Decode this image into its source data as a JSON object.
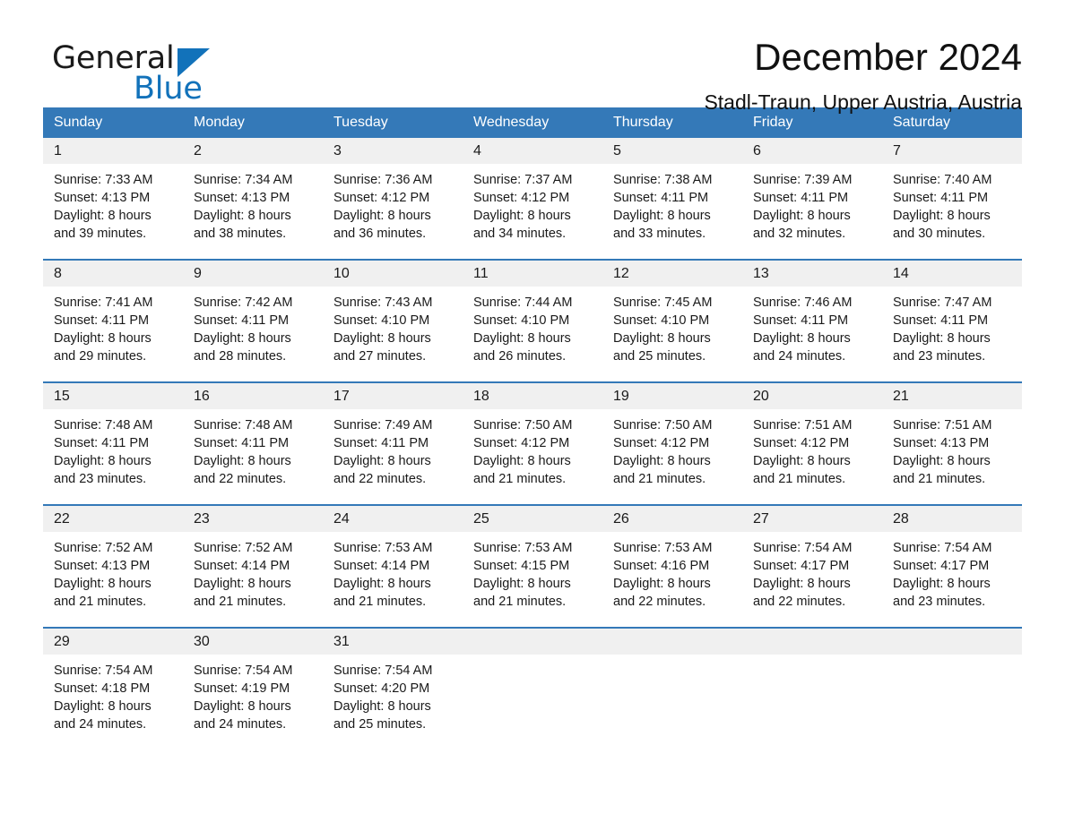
{
  "brand": {
    "name_part1": "General",
    "name_part2": "Blue",
    "triangle_icon": "triangle-icon",
    "accent_color": "#1272ba"
  },
  "header": {
    "month_title": "December 2024",
    "location": "Stadl-Traun, Upper Austria, Austria"
  },
  "calendar": {
    "header_color": "#3479b8",
    "weekdays": [
      "Sunday",
      "Monday",
      "Tuesday",
      "Wednesday",
      "Thursday",
      "Friday",
      "Saturday"
    ],
    "weeks": [
      [
        {
          "day": "1",
          "info": "Sunrise: 7:33 AM\nSunset: 4:13 PM\nDaylight: 8 hours\nand 39 minutes."
        },
        {
          "day": "2",
          "info": "Sunrise: 7:34 AM\nSunset: 4:13 PM\nDaylight: 8 hours\nand 38 minutes."
        },
        {
          "day": "3",
          "info": "Sunrise: 7:36 AM\nSunset: 4:12 PM\nDaylight: 8 hours\nand 36 minutes."
        },
        {
          "day": "4",
          "info": "Sunrise: 7:37 AM\nSunset: 4:12 PM\nDaylight: 8 hours\nand 34 minutes."
        },
        {
          "day": "5",
          "info": "Sunrise: 7:38 AM\nSunset: 4:11 PM\nDaylight: 8 hours\nand 33 minutes."
        },
        {
          "day": "6",
          "info": "Sunrise: 7:39 AM\nSunset: 4:11 PM\nDaylight: 8 hours\nand 32 minutes."
        },
        {
          "day": "7",
          "info": "Sunrise: 7:40 AM\nSunset: 4:11 PM\nDaylight: 8 hours\nand 30 minutes."
        }
      ],
      [
        {
          "day": "8",
          "info": "Sunrise: 7:41 AM\nSunset: 4:11 PM\nDaylight: 8 hours\nand 29 minutes."
        },
        {
          "day": "9",
          "info": "Sunrise: 7:42 AM\nSunset: 4:11 PM\nDaylight: 8 hours\nand 28 minutes."
        },
        {
          "day": "10",
          "info": "Sunrise: 7:43 AM\nSunset: 4:10 PM\nDaylight: 8 hours\nand 27 minutes."
        },
        {
          "day": "11",
          "info": "Sunrise: 7:44 AM\nSunset: 4:10 PM\nDaylight: 8 hours\nand 26 minutes."
        },
        {
          "day": "12",
          "info": "Sunrise: 7:45 AM\nSunset: 4:10 PM\nDaylight: 8 hours\nand 25 minutes."
        },
        {
          "day": "13",
          "info": "Sunrise: 7:46 AM\nSunset: 4:11 PM\nDaylight: 8 hours\nand 24 minutes."
        },
        {
          "day": "14",
          "info": "Sunrise: 7:47 AM\nSunset: 4:11 PM\nDaylight: 8 hours\nand 23 minutes."
        }
      ],
      [
        {
          "day": "15",
          "info": "Sunrise: 7:48 AM\nSunset: 4:11 PM\nDaylight: 8 hours\nand 23 minutes."
        },
        {
          "day": "16",
          "info": "Sunrise: 7:48 AM\nSunset: 4:11 PM\nDaylight: 8 hours\nand 22 minutes."
        },
        {
          "day": "17",
          "info": "Sunrise: 7:49 AM\nSunset: 4:11 PM\nDaylight: 8 hours\nand 22 minutes."
        },
        {
          "day": "18",
          "info": "Sunrise: 7:50 AM\nSunset: 4:12 PM\nDaylight: 8 hours\nand 21 minutes."
        },
        {
          "day": "19",
          "info": "Sunrise: 7:50 AM\nSunset: 4:12 PM\nDaylight: 8 hours\nand 21 minutes."
        },
        {
          "day": "20",
          "info": "Sunrise: 7:51 AM\nSunset: 4:12 PM\nDaylight: 8 hours\nand 21 minutes."
        },
        {
          "day": "21",
          "info": "Sunrise: 7:51 AM\nSunset: 4:13 PM\nDaylight: 8 hours\nand 21 minutes."
        }
      ],
      [
        {
          "day": "22",
          "info": "Sunrise: 7:52 AM\nSunset: 4:13 PM\nDaylight: 8 hours\nand 21 minutes."
        },
        {
          "day": "23",
          "info": "Sunrise: 7:52 AM\nSunset: 4:14 PM\nDaylight: 8 hours\nand 21 minutes."
        },
        {
          "day": "24",
          "info": "Sunrise: 7:53 AM\nSunset: 4:14 PM\nDaylight: 8 hours\nand 21 minutes."
        },
        {
          "day": "25",
          "info": "Sunrise: 7:53 AM\nSunset: 4:15 PM\nDaylight: 8 hours\nand 21 minutes."
        },
        {
          "day": "26",
          "info": "Sunrise: 7:53 AM\nSunset: 4:16 PM\nDaylight: 8 hours\nand 22 minutes."
        },
        {
          "day": "27",
          "info": "Sunrise: 7:54 AM\nSunset: 4:17 PM\nDaylight: 8 hours\nand 22 minutes."
        },
        {
          "day": "28",
          "info": "Sunrise: 7:54 AM\nSunset: 4:17 PM\nDaylight: 8 hours\nand 23 minutes."
        }
      ],
      [
        {
          "day": "29",
          "info": "Sunrise: 7:54 AM\nSunset: 4:18 PM\nDaylight: 8 hours\nand 24 minutes."
        },
        {
          "day": "30",
          "info": "Sunrise: 7:54 AM\nSunset: 4:19 PM\nDaylight: 8 hours\nand 24 minutes."
        },
        {
          "day": "31",
          "info": "Sunrise: 7:54 AM\nSunset: 4:20 PM\nDaylight: 8 hours\nand 25 minutes."
        },
        {
          "day": "",
          "info": ""
        },
        {
          "day": "",
          "info": ""
        },
        {
          "day": "",
          "info": ""
        },
        {
          "day": "",
          "info": ""
        }
      ]
    ]
  }
}
